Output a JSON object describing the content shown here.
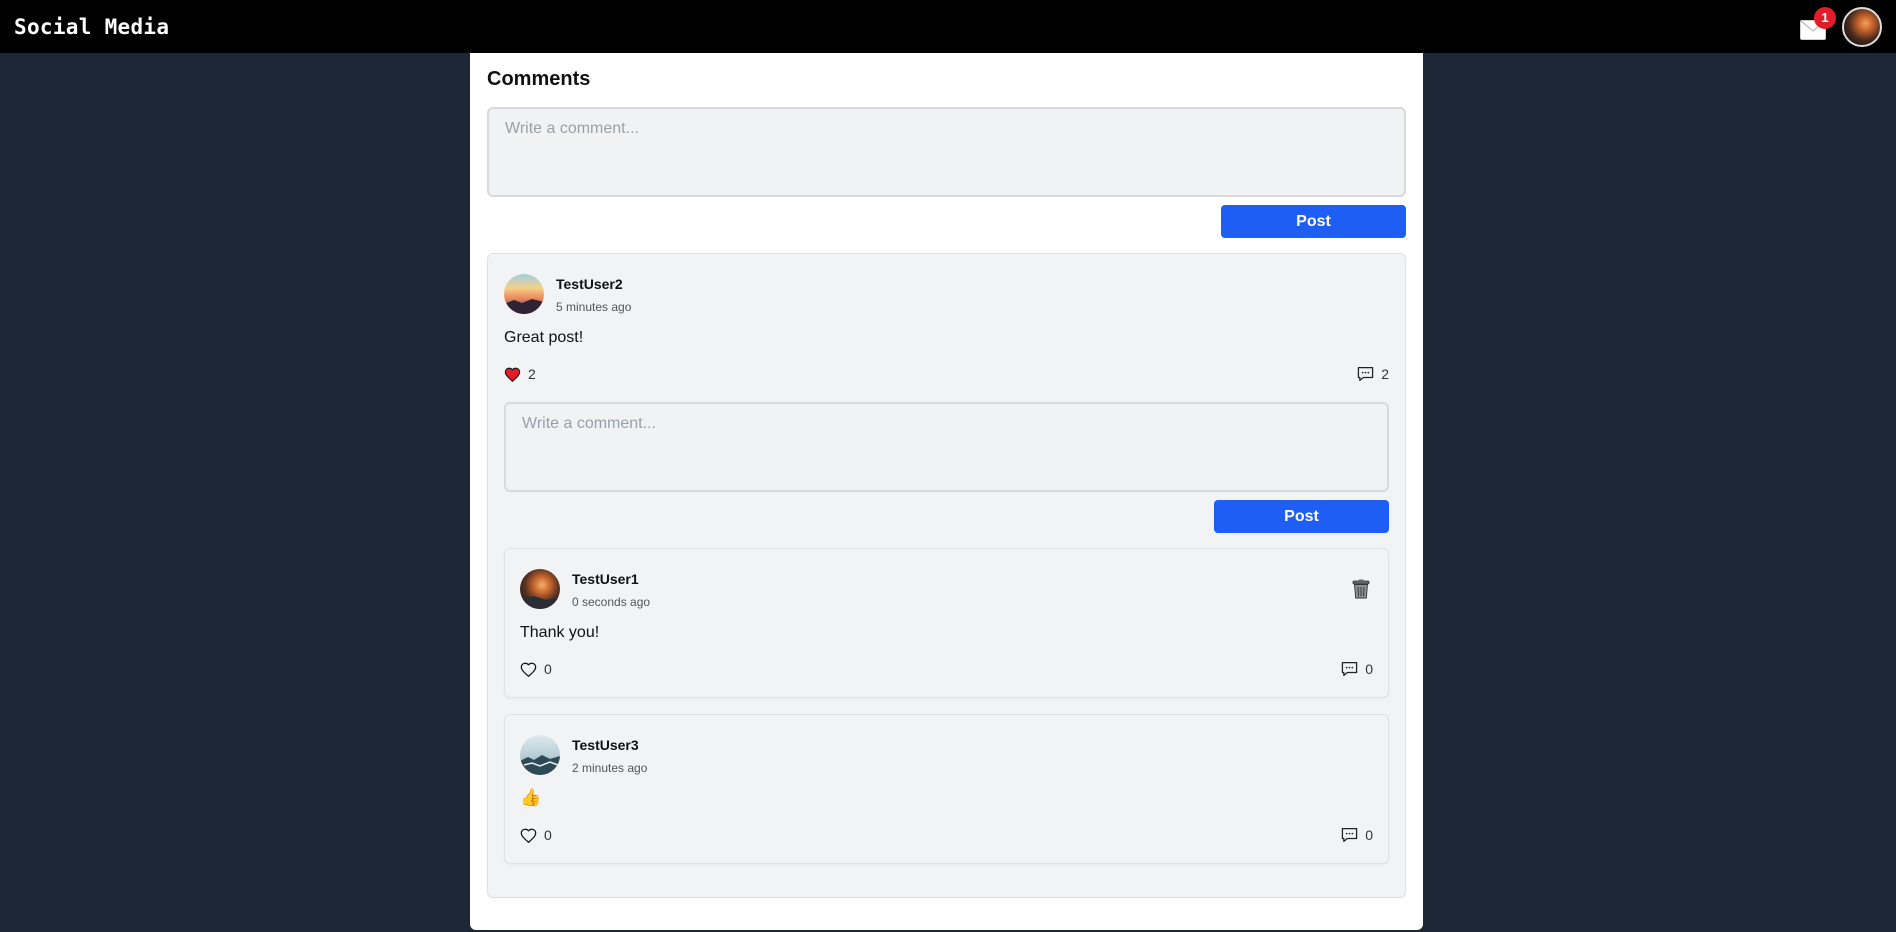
{
  "app": {
    "title": "Social Media",
    "notification_count": "1"
  },
  "icons": {
    "mail": "mail-icon",
    "heart": "heart-icon",
    "comment": "comment-icon",
    "trash": "trash-icon",
    "thumbs_up": "thumbs-up-icon"
  },
  "colors": {
    "primary": "#1f5ef5",
    "badge": "#e11d2a",
    "background": "#1e2736",
    "heart_filled": "#e11d2a"
  },
  "comments_section": {
    "title": "Comments",
    "input_placeholder": "Write a comment...",
    "post_label": "Post",
    "comments": [
      {
        "user": "TestUser2",
        "time": "5 minutes ago",
        "text": "Great post!",
        "likes": "2",
        "liked": true,
        "replies_count": "2",
        "reply_input_placeholder": "Write a comment...",
        "reply_post_label": "Post",
        "replies": [
          {
            "user": "TestUser1",
            "time": "0 seconds ago",
            "text": "Thank you!",
            "likes": "0",
            "replies_count": "0",
            "deletable": true
          },
          {
            "user": "TestUser3",
            "time": "2 minutes ago",
            "text": "👍",
            "likes": "0",
            "replies_count": "0",
            "deletable": false
          }
        ]
      }
    ]
  }
}
